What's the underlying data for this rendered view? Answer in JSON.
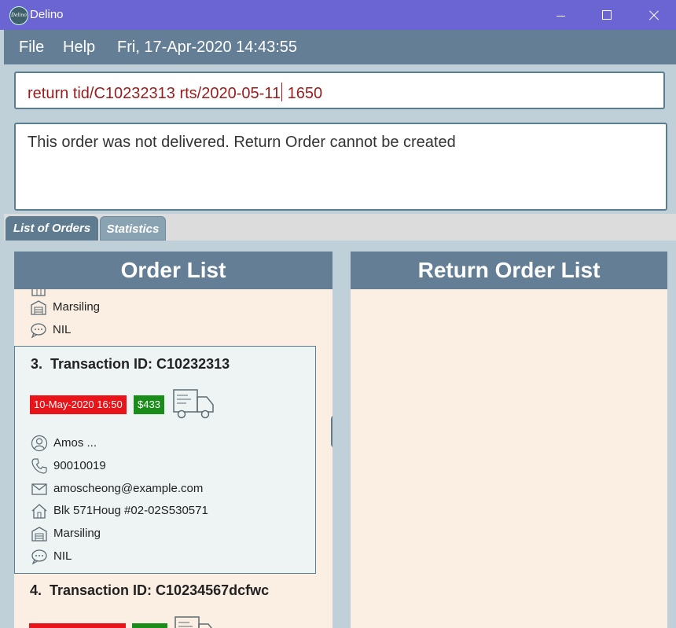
{
  "window": {
    "app_title": "Delino",
    "logo_text": "Delino"
  },
  "menu": {
    "file": "File",
    "help": "Help",
    "datetime": "Fri, 17-Apr-2020 14:43:55"
  },
  "command": {
    "before_caret": "return tid/C10232313 rts/2020-05-11",
    "after_caret": " 1650"
  },
  "result": {
    "message": "This order was not delivered. Return Order cannot be created"
  },
  "tabs": {
    "orders": "List of Orders",
    "statistics": "Statistics"
  },
  "panels": {
    "order_list_title": "Order List",
    "return_list_title": "Return Order List"
  },
  "orders": [
    {
      "partial": true,
      "warehouse": "Marsiling",
      "comment": "NIL"
    },
    {
      "index": "3.",
      "transaction_label": "Transaction ID: C10232313",
      "delivery_date": "10-May-2020 16:50",
      "price": "$433",
      "customer_name": "Amos ...",
      "phone": "90010019",
      "email": "amoscheong@example.com",
      "address": "Blk 571Houg #02-02S530571",
      "warehouse": "Marsiling",
      "comment": "NIL"
    },
    {
      "index": "4.",
      "transaction_label": "Transaction ID: C10234567dcfwc"
    }
  ],
  "colors": {
    "title_bar": "#6b65d4",
    "menu_bar": "#647f95",
    "date_badge": "#e8141a",
    "price_badge": "#1a8c1a",
    "list_bg": "#fbeee3",
    "command_text": "#9b1c1c"
  }
}
